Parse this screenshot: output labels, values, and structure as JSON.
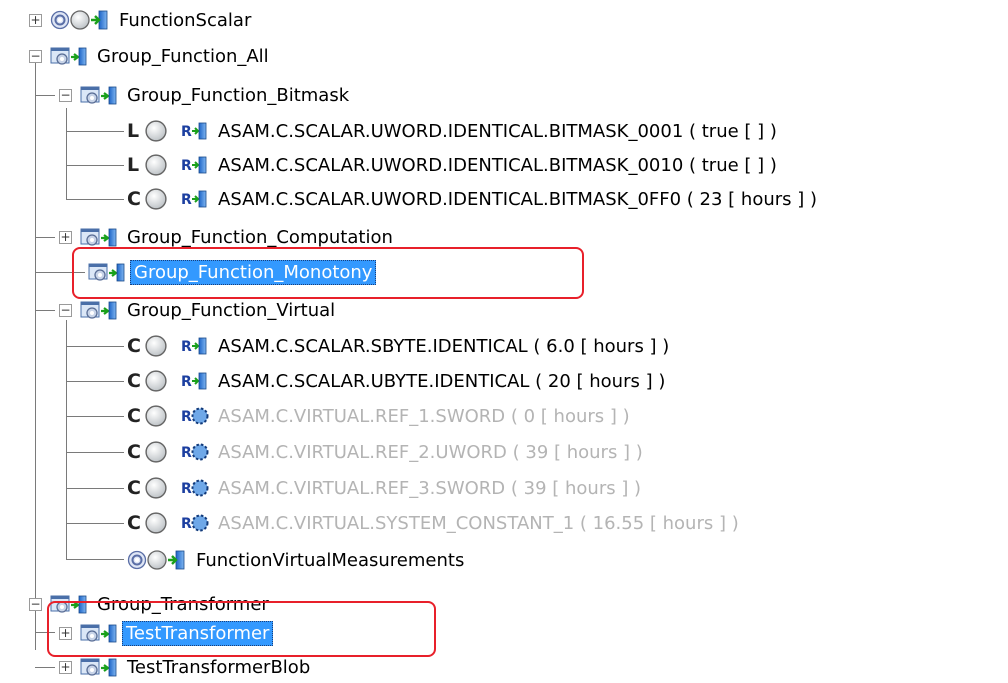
{
  "tree": {
    "nodes": [
      {
        "label": "FunctionScalar",
        "kind": "function-scalar"
      },
      {
        "label": "Group_Function_All",
        "kind": "group"
      },
      {
        "label": "Group_Function_Bitmask",
        "kind": "group"
      },
      {
        "label": "ASAM.C.SCALAR.UWORD.IDENTICAL.BITMASK_0001 ( true [  ] )",
        "kind": "leaf-L"
      },
      {
        "label": "ASAM.C.SCALAR.UWORD.IDENTICAL.BITMASK_0010 ( true [  ] )",
        "kind": "leaf-L"
      },
      {
        "label": "ASAM.C.SCALAR.UWORD.IDENTICAL.BITMASK_0FF0 ( 23 [ hours ] )",
        "kind": "leaf-C"
      },
      {
        "label": "Group_Function_Computation",
        "kind": "group"
      },
      {
        "label": "Group_Function_Monotony",
        "kind": "group",
        "selected": true
      },
      {
        "label": "Group_Function_Virtual",
        "kind": "group"
      },
      {
        "label": "ASAM.C.SCALAR.SBYTE.IDENTICAL ( 6.0 [ hours ] )",
        "kind": "leaf-C"
      },
      {
        "label": "ASAM.C.SCALAR.UBYTE.IDENTICAL ( 20 [ hours ] )",
        "kind": "leaf-C"
      },
      {
        "label": "ASAM.C.VIRTUAL.REF_1.SWORD ( 0 [ hours ] )",
        "kind": "leaf-virtual",
        "dimmed": true
      },
      {
        "label": "ASAM.C.VIRTUAL.REF_2.UWORD ( 39 [ hours ] )",
        "kind": "leaf-virtual",
        "dimmed": true
      },
      {
        "label": "ASAM.C.VIRTUAL.REF_3.SWORD ( 39 [ hours ] )",
        "kind": "leaf-virtual",
        "dimmed": true
      },
      {
        "label": "ASAM.C.VIRTUAL.SYSTEM_CONSTANT_1 ( 16.55 [ hours ] )",
        "kind": "leaf-virtual",
        "dimmed": true
      },
      {
        "label": "FunctionVirtualMeasurements",
        "kind": "function-scalar"
      },
      {
        "label": "Group_Transformer",
        "kind": "group"
      },
      {
        "label": "TestTransformer",
        "kind": "group",
        "selected": true
      },
      {
        "label": "TestTransformerBlob",
        "kind": "group"
      }
    ]
  },
  "colors": {
    "selection": "#3399ff",
    "highlight_box": "#e8202a",
    "dimmed_text": "#b4b4b4"
  }
}
